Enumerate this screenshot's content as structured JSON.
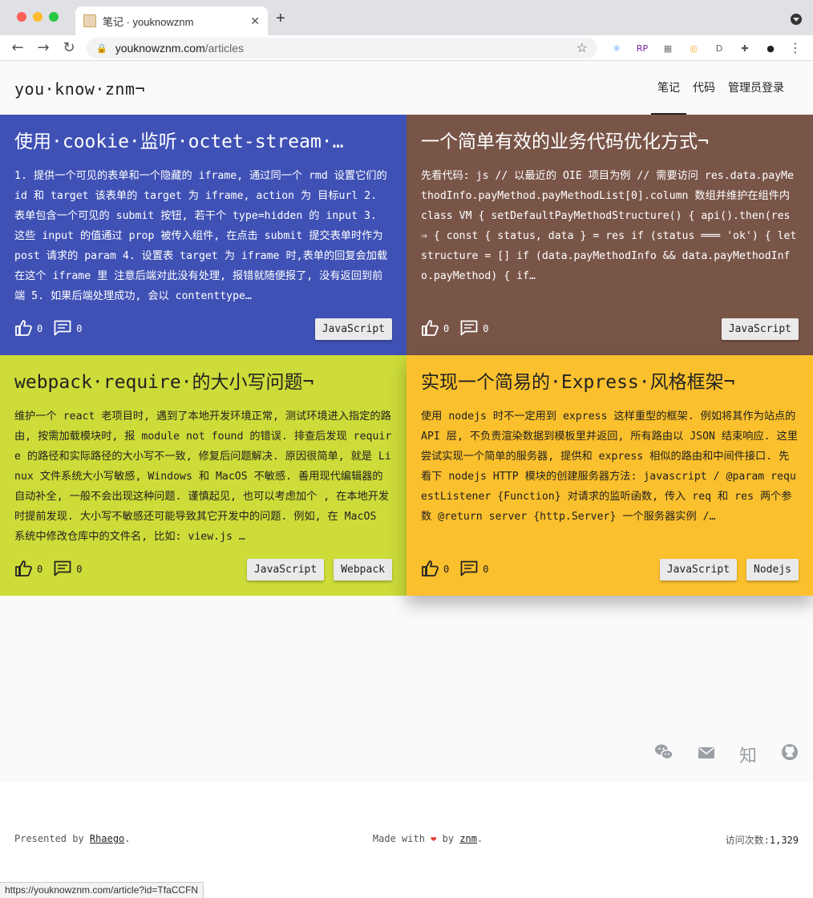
{
  "browser": {
    "tab_title": "笔记 · youknowznm",
    "tab_close": "✕",
    "new_tab": "+",
    "url_host": "youknowznm.com",
    "url_path": "/articles",
    "status_url": "https://youknowznm.com/article?id=TfaCCFN",
    "extensions": [
      {
        "label": "⚛",
        "color": "#1e90ff"
      },
      {
        "label": "RP",
        "color": "#7b1fa2"
      },
      {
        "label": "▦",
        "color": "#777"
      },
      {
        "label": "◎",
        "color": "#f5a623"
      },
      {
        "label": "D",
        "color": "#666"
      },
      {
        "label": "✚",
        "color": "#555"
      },
      {
        "label": "●",
        "color": "#222"
      }
    ]
  },
  "site": {
    "logo": "you·know·znm¬",
    "nav": [
      {
        "label": "笔记",
        "active": true
      },
      {
        "label": "代码",
        "active": false
      },
      {
        "label": "管理员登录",
        "active": false
      }
    ]
  },
  "cards": [
    {
      "title": "使用·cookie·监听·octet-stream·…",
      "body": "1. 提供一个可见的表单和一个隐藏的 iframe, 通过同一个 rmd 设置它们的 id 和 target 该表单的 target 为 iframe, action 为 目标url 2. 表单包含一个可见的 submit 按钮, 若干个 type=hidden 的 input 3. 这些 input 的值通过 prop 被传入组件, 在点击 submit 提交表单时作为 post 请求的 param 4. 设置表 target 为 iframe 时,表单的回复会加载在这个 iframe 里 注意后端对此没有处理, 报错就随便报了, 没有返回到前端 5. 如果后端处理成功, 会以 contenttype…",
      "likes": "0",
      "comments": "0",
      "tags": [
        "JavaScript"
      ],
      "bg": "#3f51b5",
      "fg": "#ffffff"
    },
    {
      "title": "一个简单有效的业务代码优化方式¬",
      "body": "先看代码: js // 以最近的 OIE 项目为例 // 需要访问 res.data.payMethodInfo.payMethod.payMethodList[0].column 数组并维护在组件内 class VM { setDefaultPayMethodStructure() { api().then(res ⇒ { const { status, data } = res if (status ═══ 'ok') { let structure = [] if (data.payMethodInfo && data.payMethodInfo.payMethod) { if…",
      "likes": "0",
      "comments": "0",
      "tags": [
        "JavaScript"
      ],
      "bg": "#795548",
      "fg": "#ffffff"
    },
    {
      "title": "webpack·require·的大小写问题¬",
      "body": "维护一个 react 老项目时, 遇到了本地开发环境正常, 测试环境进入指定的路由, 按需加载模块时, 报 module not found 的错误. 排查后发现 require 的路径和实际路径的大小写不一致, 修复后问题解决. 原因很简单, 就是 Linux 文件系统大小写敏感, Windows 和 MacOS 不敏感. 善用现代编辑器的自动补全, 一般不会出现这种问题. 谨慎起见, 也可以考虑加个 , 在本地开发时提前发现. 大小写不敏感还可能导致其它开发中的问题. 例如, 在 MacOS 系统中修改仓库中的文件名, 比如: view.js …",
      "likes": "0",
      "comments": "0",
      "tags": [
        "JavaScript",
        "Webpack"
      ],
      "bg": "#cddc39",
      "fg": "#222222"
    },
    {
      "title": "实现一个简易的·Express·风格框架¬",
      "body": "使用 nodejs 时不一定用到 express 这样重型的框架. 例如将其作为站点的 API 层, 不负责渲染数据到模板里并返回, 所有路由以 JSON 结束响应. 这里尝试实现一个简单的服务器, 提供和 express 相似的路由和中间件接口. 先看下 nodejs HTTP 模块的创建服务器方法: javascript / @param requestListener {Function} 对请求的监听函数, 传入 req 和 res 两个参数 @return server {http.Server} 一个服务器实例 /…",
      "likes": "0",
      "comments": "0",
      "tags": [
        "JavaScript",
        "Nodejs"
      ],
      "bg": "#fbc02d",
      "fg": "#222222"
    }
  ],
  "social": [
    "wechat-icon",
    "mail-icon",
    "zhihu-icon",
    "github-icon"
  ],
  "social_zhihu_glyph": "知",
  "footer": {
    "presented_prefix": "Presented by ",
    "presented_name": "Rhaego",
    "presented_suffix": ".",
    "made_prefix": "Made with ",
    "heart": "❤",
    "made_by": " by ",
    "made_name": "znm",
    "made_suffix": ".",
    "visits_label": "访问次数:",
    "visits_count": "1,329"
  }
}
